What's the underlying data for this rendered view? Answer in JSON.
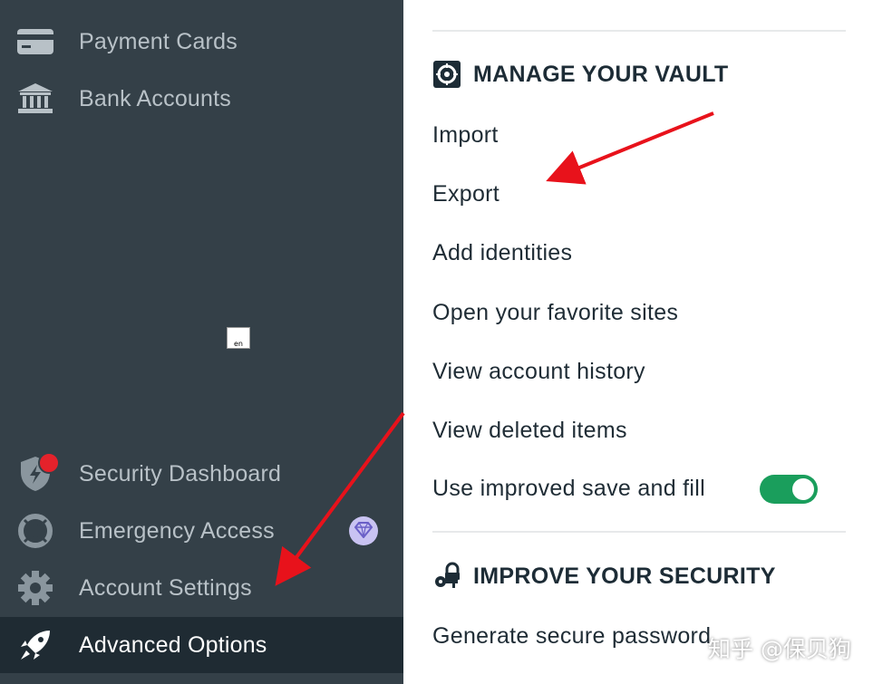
{
  "sidebar": {
    "items": [
      {
        "label": "Payment Cards",
        "icon": "credit-card-icon"
      },
      {
        "label": "Bank Accounts",
        "icon": "bank-icon"
      },
      {
        "label": "Security Dashboard",
        "icon": "shield-icon"
      },
      {
        "label": "Emergency Access",
        "icon": "lifebuoy-icon"
      },
      {
        "label": "Account Settings",
        "icon": "gear-icon"
      },
      {
        "label": "Advanced Options",
        "icon": "rocket-icon"
      }
    ],
    "emergency_badge_icon": "diamond-icon",
    "widget_text": "en"
  },
  "manage_vault": {
    "title": "MANAGE YOUR VAULT",
    "icon": "vault-icon",
    "links": {
      "import": "Import",
      "export": "Export",
      "add_identities": "Add identities",
      "favorite_sites": "Open your favorite sites",
      "account_history": "View account history",
      "deleted_items": "View deleted items",
      "save_fill": "Use improved save and fill"
    },
    "save_fill_enabled": true
  },
  "improve_security": {
    "title": "IMPROVE YOUR SECURITY",
    "icon": "keys-icon",
    "links": {
      "generate_password": "Generate secure password"
    }
  },
  "watermark": "知乎 @保贝狗",
  "colors": {
    "sidebar_bg": "#344048",
    "sidebar_active_bg": "#1f2b33",
    "toggle_on": "#1a9e5c",
    "notification": "#e4222b",
    "annotation_arrow": "#e8121b"
  }
}
